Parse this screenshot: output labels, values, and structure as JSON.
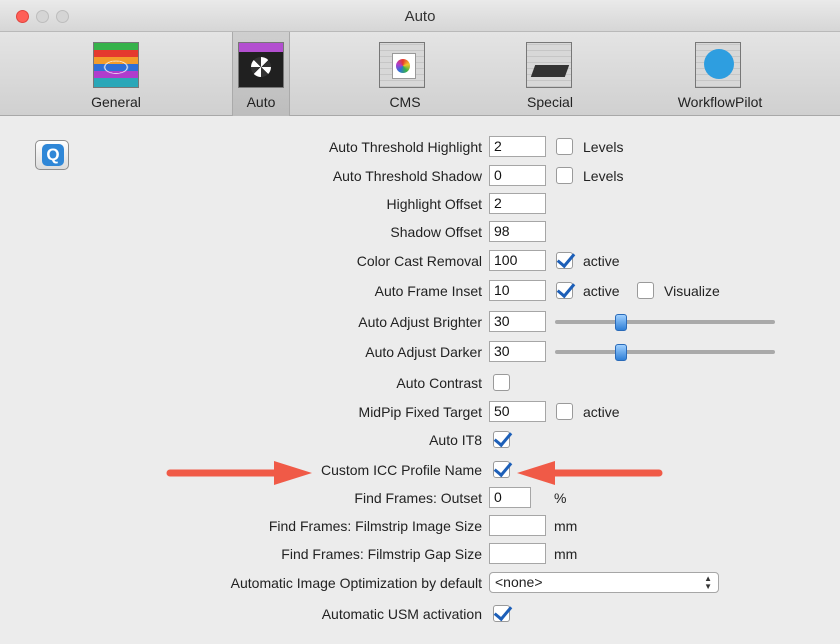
{
  "window": {
    "title": "Auto"
  },
  "toolbar": {
    "tabs": [
      {
        "label": "General",
        "icon": "general-icon"
      },
      {
        "label": "Auto",
        "icon": "auto-icon",
        "selected": true
      },
      {
        "label": "CMS",
        "icon": "cms-icon"
      },
      {
        "label": "Special",
        "icon": "special-icon"
      },
      {
        "label": "WorkflowPilot",
        "icon": "workflowpilot-icon"
      }
    ]
  },
  "quick_button": {
    "glyph": "Q",
    "icon": "quick-help-icon"
  },
  "settings": {
    "auto_threshold_highlight": {
      "label": "Auto Threshold Highlight",
      "value": "2",
      "check_label": "Levels",
      "checked": false
    },
    "auto_threshold_shadow": {
      "label": "Auto Threshold Shadow",
      "value": "0",
      "check_label": "Levels",
      "checked": false
    },
    "highlight_offset": {
      "label": "Highlight Offset",
      "value": "2"
    },
    "shadow_offset": {
      "label": "Shadow Offset",
      "value": "98"
    },
    "color_cast_removal": {
      "label": "Color Cast Removal",
      "value": "100",
      "check_label": "active",
      "checked": true
    },
    "auto_frame_inset": {
      "label": "Auto Frame Inset",
      "value": "10",
      "check_label": "active",
      "checked": true,
      "check2_label": "Visualize",
      "checked2": false
    },
    "auto_adjust_brighter": {
      "label": "Auto Adjust Brighter",
      "value": "30",
      "slider_fraction": 0.3
    },
    "auto_adjust_darker": {
      "label": "Auto Adjust Darker",
      "value": "30",
      "slider_fraction": 0.3
    },
    "auto_contrast": {
      "label": "Auto Contrast",
      "checked": false
    },
    "midpip_fixed_target": {
      "label": "MidPip Fixed Target",
      "value": "50",
      "check_label": "active",
      "checked": false
    },
    "auto_it8": {
      "label": "Auto IT8",
      "checked": true
    },
    "custom_icc_profile_name": {
      "label": "Custom ICC Profile Name",
      "checked": true
    },
    "find_frames_outset": {
      "label": "Find Frames: Outset",
      "value": "0",
      "unit": "%"
    },
    "find_frames_filmstrip_image_size": {
      "label": "Find Frames: Filmstrip Image Size",
      "value": "",
      "unit": "mm"
    },
    "find_frames_filmstrip_gap_size": {
      "label": "Find Frames: Filmstrip Gap Size",
      "value": "",
      "unit": "mm"
    },
    "automatic_image_optimization": {
      "label": "Automatic Image Optimization by default",
      "value": "<none>"
    },
    "automatic_usm_activation": {
      "label": "Automatic USM activation",
      "checked": true
    }
  },
  "colors": {
    "annotation_arrow": "#f05a47",
    "checkmark": "#1d5fb8",
    "close_button": "#ff5f57"
  }
}
